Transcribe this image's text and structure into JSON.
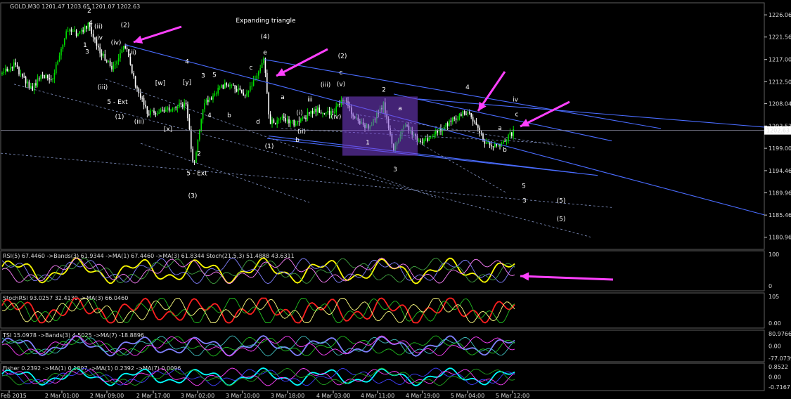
{
  "chart_data": [
    {
      "type": "candlestick",
      "title": "GOLD,M30",
      "ohlc": {
        "open": "1201.47",
        "high": "1203.65",
        "low": "1201.07",
        "close": "1202.63"
      },
      "current_price": "1202.63",
      "ylim": [
        1178.5,
        1228.5
      ],
      "y_ticks": [
        "1226.06",
        "1221.56",
        "1217.00",
        "1212.50",
        "1208.04",
        "1203.53",
        "1199.00",
        "1194.46",
        "1189.96",
        "1185.46",
        "1180.96"
      ],
      "x_ticks": [
        "27 Feb 2015",
        "2 Mar 01:00",
        "2 Mar 09:00",
        "2 Mar 17:00",
        "3 Mar 02:00",
        "3 Mar 10:00",
        "3 Mar 18:00",
        "4 Mar 03:00",
        "4 Mar 11:00",
        "4 Mar 19:00",
        "5 Mar 04:00",
        "5 Mar 12:00"
      ],
      "annotation": "Expanding triangle",
      "wave_labels": [
        {
          "t": "2",
          "x": 127,
          "y": 1226.5,
          "c": "#ff2020"
        },
        {
          "t": "4",
          "x": 129,
          "y": 1224.0,
          "c": "#ff2020"
        },
        {
          "t": "(ii)",
          "x": 140,
          "y": 1223.3,
          "c": "#ff8000"
        },
        {
          "t": "iv",
          "x": 142,
          "y": 1221.0,
          "c": "#c000c0"
        },
        {
          "t": "1",
          "x": 121,
          "y": 1219.5,
          "c": "#ff2020"
        },
        {
          "t": "3",
          "x": 124,
          "y": 1218.2,
          "c": "#ff2020"
        },
        {
          "t": "(iv)",
          "x": 165,
          "y": 1220.0,
          "c": "#ff8000"
        },
        {
          "t": "(2)",
          "x": 178,
          "y": 1223.6,
          "c": "#ffff00",
          "big": true
        },
        {
          "t": "(ii)",
          "x": 188,
          "y": 1218.0,
          "c": "#ff8000"
        },
        {
          "t": "(iii)",
          "x": 146,
          "y": 1211.0,
          "c": "#ff8000"
        },
        {
          "t": "5 - Ext",
          "x": 167,
          "y": 1208.0,
          "c": "#ff2020"
        },
        {
          "t": "(1)",
          "x": 170,
          "y": 1205.0,
          "c": "#ffff00",
          "big": true
        },
        {
          "t": "(iii)",
          "x": 198,
          "y": 1204.0,
          "c": "#ff8000"
        },
        {
          "t": "[w]",
          "x": 228,
          "y": 1211.8,
          "c": "#ffffff"
        },
        {
          "t": "[y]",
          "x": 266,
          "y": 1212.0,
          "c": "#ffffff"
        },
        {
          "t": "[x]",
          "x": 239,
          "y": 1202.5,
          "c": "#ffffff"
        },
        {
          "t": "4",
          "x": 266,
          "y": 1216.2,
          "c": "#ff2020"
        },
        {
          "t": "3",
          "x": 289,
          "y": 1213.3,
          "c": "#ff2020"
        },
        {
          "t": "5",
          "x": 305,
          "y": 1213.5,
          "c": "#ff2020"
        },
        {
          "t": "4",
          "x": 298,
          "y": 1205.3,
          "c": "#ff2020"
        },
        {
          "t": "2",
          "x": 283,
          "y": 1197.5,
          "c": "#ff2020"
        },
        {
          "t": "b",
          "x": 326,
          "y": 1205.3,
          "c": "#ffff00"
        },
        {
          "t": "5 - Ext",
          "x": 280,
          "y": 1193.5,
          "c": "#ff2020"
        },
        {
          "t": "(3)",
          "x": 274,
          "y": 1189.0,
          "c": "#ffff00",
          "big": true
        },
        {
          "t": "(4)",
          "x": 377,
          "y": 1221.2,
          "c": "#ffff00",
          "big": true
        },
        {
          "t": "e",
          "x": 377,
          "y": 1218.0,
          "c": "#ffffff"
        },
        {
          "t": "c",
          "x": 357,
          "y": 1215.0,
          "c": "#ffff00"
        },
        {
          "t": "a",
          "x": 402,
          "y": 1209.0,
          "c": "#ffff00"
        },
        {
          "t": "d",
          "x": 367,
          "y": 1204.0,
          "c": "#ffff00"
        },
        {
          "t": "b",
          "x": 423,
          "y": 1200.3,
          "c": "#ffff00"
        },
        {
          "t": "(1)",
          "x": 383,
          "y": 1199.0,
          "c": "#ff2020"
        },
        {
          "t": "(i)",
          "x": 426,
          "y": 1205.8,
          "c": "#ff8000"
        },
        {
          "t": "(ii)",
          "x": 429,
          "y": 1202.0,
          "c": "#ff8000"
        },
        {
          "t": "iii",
          "x": 441,
          "y": 1208.5,
          "c": "#c000c0"
        },
        {
          "t": "(2)",
          "x": 487,
          "y": 1217.3,
          "c": "#ff2020",
          "big": true
        },
        {
          "t": "c",
          "x": 485,
          "y": 1214.0,
          "c": "#ffff00"
        },
        {
          "t": "(iii)",
          "x": 463,
          "y": 1211.5,
          "c": "#ff8000"
        },
        {
          "t": "(v)",
          "x": 485,
          "y": 1211.6,
          "c": "#ff8000"
        },
        {
          "t": "(iv)",
          "x": 478,
          "y": 1205.0,
          "c": "#ff8000"
        },
        {
          "t": "1",
          "x": 523,
          "y": 1199.8,
          "c": "#ffff00"
        },
        {
          "t": "2",
          "x": 546,
          "y": 1210.5,
          "c": "#ffff00"
        },
        {
          "t": "a",
          "x": 569,
          "y": 1206.7,
          "c": "#ffff00"
        },
        {
          "t": "3",
          "x": 562,
          "y": 1194.3,
          "c": "#ffff00"
        },
        {
          "t": "4",
          "x": 665,
          "y": 1211.0,
          "c": "#ffff00"
        },
        {
          "t": "iv",
          "x": 733,
          "y": 1208.5,
          "c": "#c000c0"
        },
        {
          "t": "c",
          "x": 735,
          "y": 1205.5,
          "c": "#ffff00"
        },
        {
          "t": "a",
          "x": 711,
          "y": 1202.7,
          "c": "#ffff00"
        },
        {
          "t": "b",
          "x": 718,
          "y": 1198.3,
          "c": "#ffff00"
        },
        {
          "t": "5",
          "x": 745,
          "y": 1191.0,
          "c": "#ffff00"
        },
        {
          "t": "3",
          "x": 746,
          "y": 1188.0,
          "c": "#ff2020"
        },
        {
          "t": "(5)",
          "x": 798,
          "y": 1188.0,
          "c": "#ff2020",
          "big": true
        },
        {
          "t": "(5)",
          "x": 798,
          "y": 1184.3,
          "c": "#ffff00",
          "big": true
        }
      ],
      "arrows": [
        {
          "from": [
            258,
            38
          ],
          "to": [
            190,
            60
          ]
        },
        {
          "from": [
            466,
            70
          ],
          "to": [
            393,
            108
          ]
        },
        {
          "from": [
            718,
            102
          ],
          "to": [
            680,
            158
          ]
        },
        {
          "from": [
            810,
            145
          ],
          "to": [
            740,
            180
          ]
        }
      ],
      "purple_box": {
        "x1": 487,
        "x2": 594,
        "y_top": 1209.5,
        "y_bottom": 1197.5
      },
      "colors": {
        "up": "#00e000",
        "down": "#ffffff",
        "background": "#000000",
        "grid": "#606060",
        "trend": "#4a6cff",
        "arrow": "#ff40ff"
      }
    },
    {
      "type": "line",
      "title": "RSI(5) 67.4460 ->Bands(3) 61.9344 ->MA(1) 67.4460 ->MA(3) 61.8344 Stoch(21,5,3) 51.4888 43.6311",
      "ylim": [
        0,
        100
      ],
      "y_ticks": [
        "100",
        "0"
      ]
    },
    {
      "type": "line",
      "title": "StochRSI 93.0257 32.4130 ->MA(3) 66.0460",
      "ylim": [
        0,
        105
      ],
      "y_ticks": [
        "105",
        "0.00"
      ]
    },
    {
      "type": "line",
      "title": "TSI 15.0978 ->Bands(3) 4.5025 ->MA(7) -18.8896",
      "ylim": [
        -77.0739,
        80.9766
      ],
      "y_ticks": [
        "80.9766",
        "0.00",
        "-77.0739"
      ]
    },
    {
      "type": "line",
      "title": "Fisher 0.2392 ->MA(1) 0.1897 ->MA(1) 0.2392 ->MA(7) 0.0096",
      "ylim": [
        -0.7167,
        0.8522
      ],
      "y_ticks": [
        "0.8522",
        "0.00",
        "-0.7167"
      ]
    }
  ]
}
